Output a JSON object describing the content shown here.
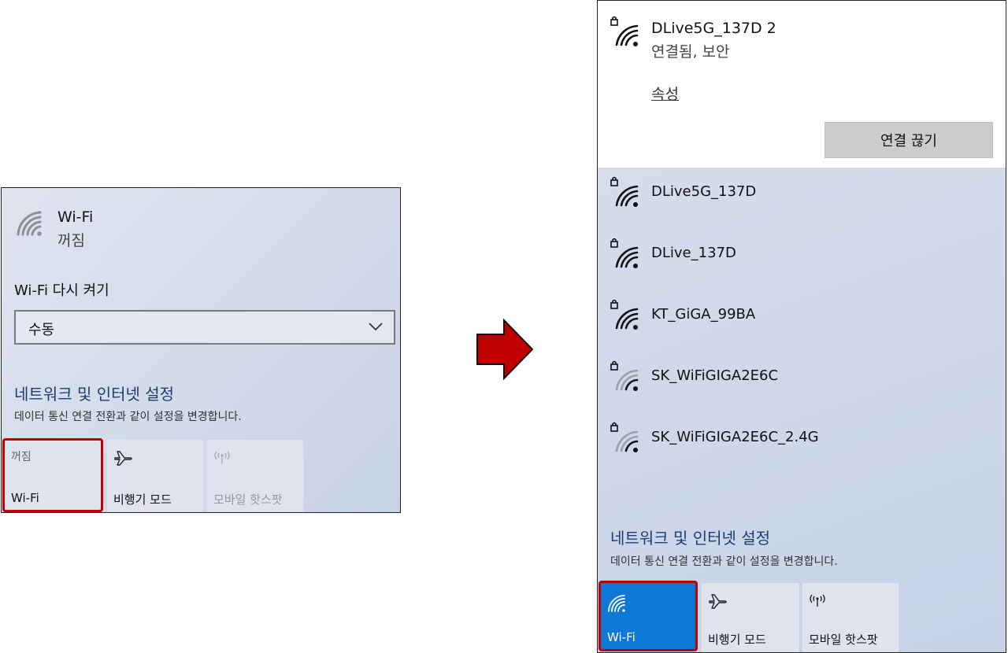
{
  "left": {
    "wifi_title": "Wi-Fi",
    "wifi_status": "꺼짐",
    "reenable_label": "Wi-Fi 다시 켜기",
    "reenable_value": "수동",
    "settings_title": "네트워크 및 인터넷 설정",
    "settings_subtitle": "데이터 통신 연결 전환과 같이 설정을 변경합니다.",
    "tiles": [
      {
        "top": "꺼짐",
        "label": "Wi-Fi",
        "icon": "wifi-off"
      },
      {
        "label": "비행기 모드",
        "icon": "airplane-icon"
      },
      {
        "label": "모바일 핫스팟",
        "icon": "hotspot-icon"
      }
    ]
  },
  "right": {
    "connected": {
      "name": "DLive5G_137D 2",
      "status": "연결됨, 보안",
      "properties": "속성",
      "disconnect": "연결 끊기"
    },
    "networks": [
      {
        "name": "DLive5G_137D",
        "strength": 4
      },
      {
        "name": "DLive_137D",
        "strength": 4
      },
      {
        "name": "KT_GiGA_99BA",
        "strength": 4
      },
      {
        "name": "SK_WiFiGIGA2E6C",
        "strength": 2
      },
      {
        "name": "SK_WiFiGIGA2E6C_2.4G",
        "strength": 2
      }
    ],
    "settings_title": "네트워크 및 인터넷 설정",
    "settings_subtitle": "데이터 통신 연결 전환과 같이 설정을 변경합니다.",
    "tiles": [
      {
        "label": "Wi-Fi",
        "icon": "wifi-icon"
      },
      {
        "label": "비행기 모드",
        "icon": "airplane-icon"
      },
      {
        "label": "모바일 핫스팟",
        "icon": "hotspot-icon"
      }
    ]
  },
  "colors": {
    "highlight": "#c00000",
    "wifi_on": "#0d78d6",
    "link": "#1b3f73",
    "arrow": "#c00000"
  }
}
